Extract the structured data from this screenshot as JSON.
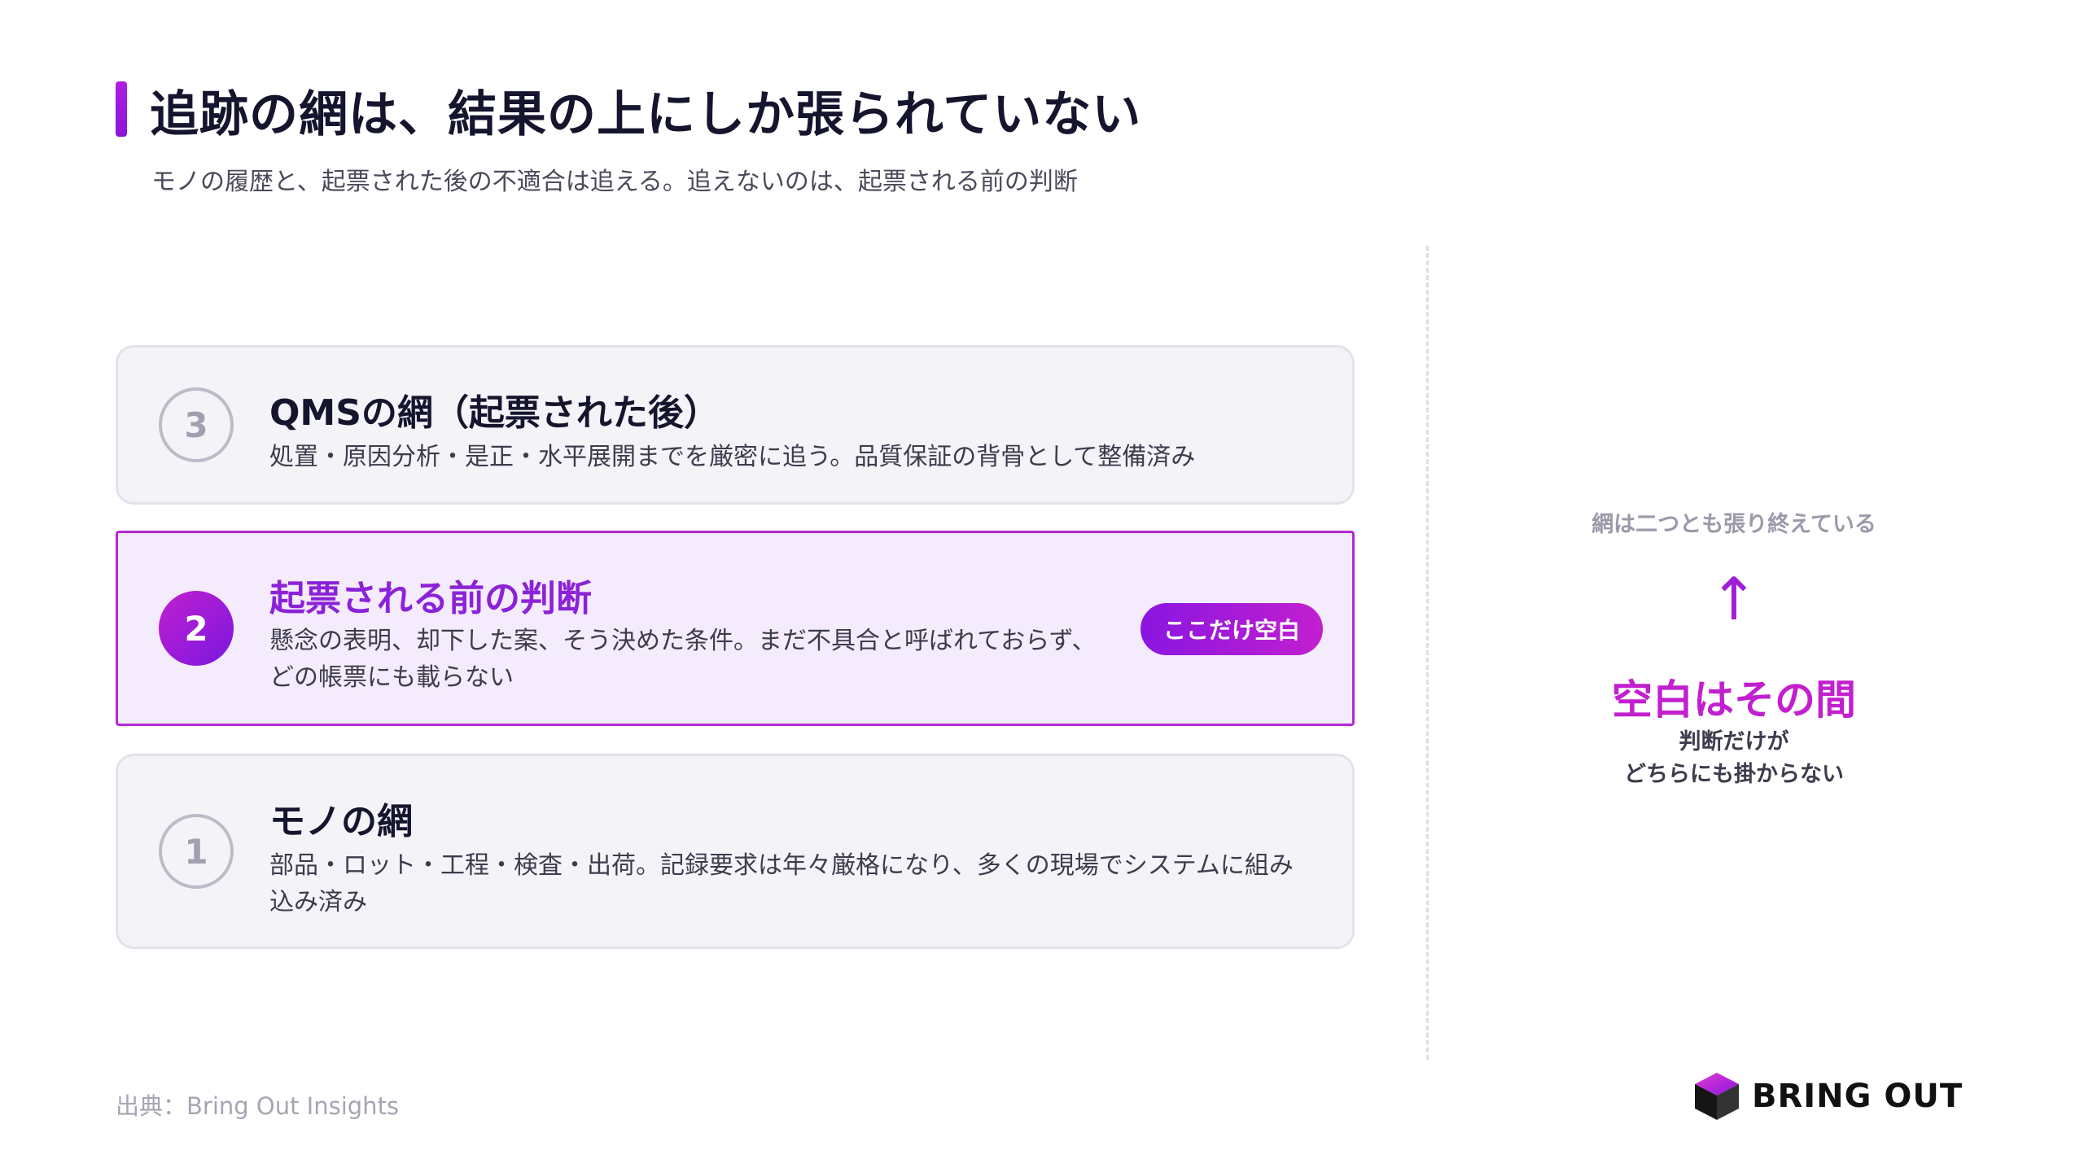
{
  "header": {
    "title": "追跡の網は、結果の上にしか張られていない",
    "subtitle": "モノの履歴と、起票された後の不適合は追える。追えないのは、起票される前の判断"
  },
  "layers": [
    {
      "number": "3",
      "title": "QMSの網（起票された後）",
      "description": "処置・原因分析・是正・水平展開までを厳密に追う。品質保証の背骨として整備済み"
    },
    {
      "number": "2",
      "title": "起票される前の判断",
      "description": "懸念の表明、却下した案、そう決めた条件。まだ不具合と呼ばれておらず、どの帳票にも載らない",
      "badge": "ここだけ空白"
    },
    {
      "number": "1",
      "title": "モノの網",
      "description": "部品・ロット・工程・検査・出荷。記録要求は年々厳格になり、多くの現場でシステムに組み込み済み"
    }
  ],
  "side_panel": {
    "top_note": "網は二つとも張り終えている",
    "arrow": "↑",
    "main": "空白はその間",
    "note_line1": "判断だけが",
    "note_line2": "どちらにも掛からない"
  },
  "footer": {
    "source": "出典：Bring Out Insights",
    "logo_text": "BRING OUT"
  },
  "colors": {
    "accent": "#c21fcf",
    "accent_deep": "#8b22d8",
    "card_bg": "#f3f3f8",
    "highlight_bg": "#f4ebfc"
  }
}
